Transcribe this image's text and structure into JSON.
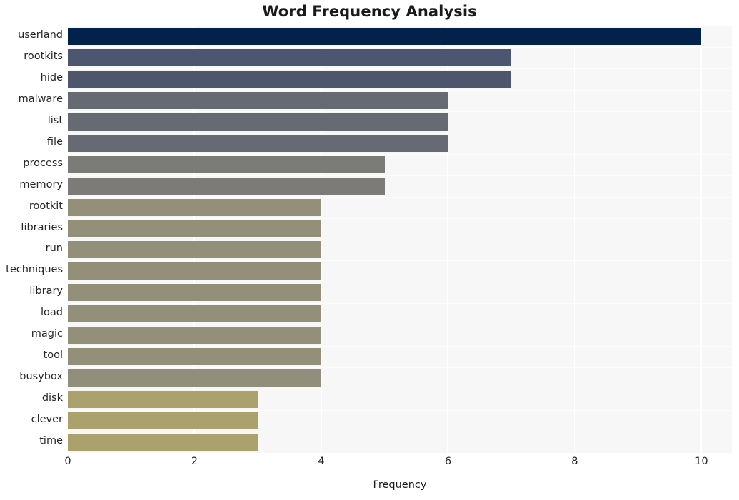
{
  "chart_data": {
    "type": "bar",
    "orientation": "horizontal",
    "title": "Word Frequency Analysis",
    "xlabel": "Frequency",
    "ylabel": "",
    "categories": [
      "userland",
      "rootkits",
      "hide",
      "malware",
      "list",
      "file",
      "process",
      "memory",
      "rootkit",
      "libraries",
      "run",
      "techniques",
      "library",
      "load",
      "magic",
      "tool",
      "busybox",
      "disk",
      "clever",
      "time"
    ],
    "values": [
      10,
      7,
      7,
      6,
      6,
      6,
      5,
      5,
      4,
      4,
      4,
      4,
      4,
      4,
      4,
      4,
      4,
      3,
      3,
      3
    ],
    "bar_colors": [
      "#02224c",
      "#4d5670",
      "#4e566d",
      "#666a73",
      "#666a73",
      "#666a73",
      "#7b7b78",
      "#7c7b77",
      "#948f79",
      "#948f79",
      "#948f79",
      "#948f79",
      "#948f79",
      "#948f79",
      "#948f79",
      "#948f79",
      "#918e7b",
      "#aaa16d",
      "#aaa16d",
      "#aaa16d"
    ],
    "xlim": [
      0,
      10.48
    ],
    "xticks": [
      0,
      2,
      4,
      6,
      8,
      10
    ],
    "xtick_labels": [
      "0",
      "2",
      "4",
      "6",
      "8",
      "10"
    ],
    "grid": {
      "vertical": true,
      "horizontal": true,
      "color": "#ffffff"
    },
    "legend": null,
    "plot_background": "#f7f7f7",
    "figure_background": "#ffffff"
  }
}
